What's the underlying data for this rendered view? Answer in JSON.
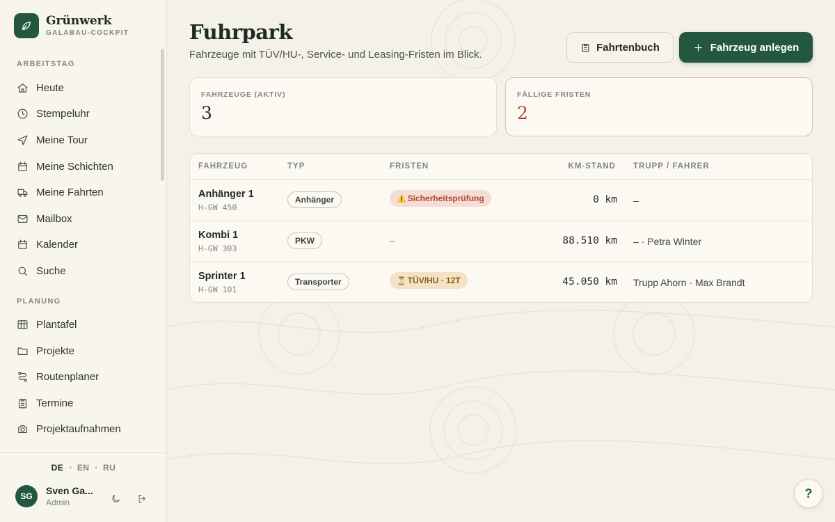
{
  "brand": {
    "name": "Grünwerk",
    "subtitle": "GALABAU-COCKPIT",
    "icon": "leaf-icon"
  },
  "sidebar": {
    "sections": [
      {
        "label": "ARBEITSTAG"
      },
      {
        "label": "PLANUNG"
      }
    ],
    "items": [
      {
        "label": "Heute",
        "icon": "home-icon"
      },
      {
        "label": "Stempeluhr",
        "icon": "clock-icon"
      },
      {
        "label": "Meine Tour",
        "icon": "navigation-icon"
      },
      {
        "label": "Meine Schichten",
        "icon": "calendar-icon"
      },
      {
        "label": "Meine Fahrten",
        "icon": "truck-icon"
      },
      {
        "label": "Mailbox",
        "icon": "mail-icon"
      },
      {
        "label": "Kalender",
        "icon": "calendar-icon"
      },
      {
        "label": "Suche",
        "icon": "search-icon"
      },
      {
        "label": "Plantafel",
        "icon": "board-icon"
      },
      {
        "label": "Projekte",
        "icon": "folder-icon"
      },
      {
        "label": "Routenplaner",
        "icon": "route-icon"
      },
      {
        "label": "Termine",
        "icon": "clipboard-icon"
      },
      {
        "label": "Projektaufnahmen",
        "icon": "camera-icon"
      }
    ],
    "languages": [
      {
        "code": "DE",
        "active": true
      },
      {
        "code": "EN",
        "active": false
      },
      {
        "code": "RU",
        "active": false
      }
    ],
    "user": {
      "initials": "SG",
      "name": "Sven Ga...",
      "role": "Admin"
    }
  },
  "header": {
    "title": "Fuhrpark",
    "subtitle": "Fahrzeuge mit TÜV/HU-, Service- und Leasing-Fristen im Blick.",
    "secondary_button": "Fahrtenbuch",
    "primary_button": "Fahrzeug anlegen"
  },
  "stats": [
    {
      "label": "FAHRZEUGE (AKTIV)",
      "value": "3"
    },
    {
      "label": "FÄLLIGE FRISTEN",
      "value": "2"
    }
  ],
  "table": {
    "columns": [
      "FAHRZEUG",
      "TYP",
      "FRISTEN",
      "KM-STAND",
      "TRUPP / FAHRER"
    ],
    "rows": [
      {
        "name": "Anhänger 1",
        "plate": "H-GW 450",
        "type": "Anhänger",
        "deadline_emoji": "⚠️",
        "deadline": "Sicherheitsprüfung",
        "deadline_status": "overdue",
        "km": "0 km",
        "crew": "–"
      },
      {
        "name": "Kombi 1",
        "plate": "H-GW 303",
        "type": "PKW",
        "deadline_emoji": "",
        "deadline": "–",
        "deadline_status": "none",
        "km": "88.510 km",
        "crew": "– · Petra Winter"
      },
      {
        "name": "Sprinter 1",
        "plate": "H-GW 101",
        "type": "Transporter",
        "deadline_emoji": "⏳",
        "deadline": "TÜV/HU · 12T",
        "deadline_status": "soon",
        "km": "45.050 km",
        "crew": "Trupp Ahorn · Max Brandt"
      }
    ]
  },
  "help": {
    "label": "?"
  },
  "colors": {
    "accent": "#24573f",
    "background": "#f4f1e8",
    "danger": "#b0452e",
    "warning": "#8a5a12"
  }
}
